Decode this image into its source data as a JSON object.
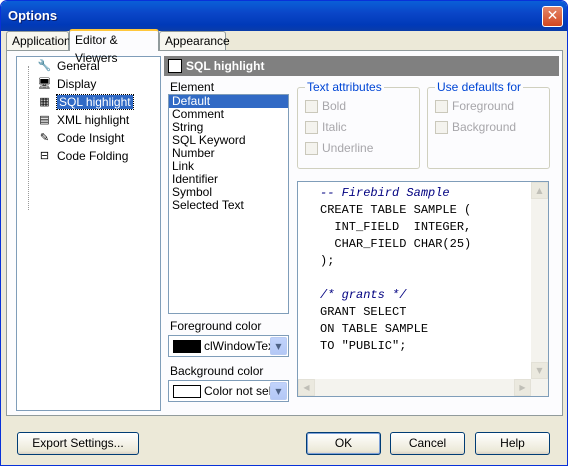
{
  "window": {
    "title": "Options"
  },
  "tabs": [
    {
      "label": "Application"
    },
    {
      "label": "Editor & Viewers"
    },
    {
      "label": "Appearance"
    }
  ],
  "tree": {
    "items": [
      {
        "label": "General",
        "icon": "wrench-icon"
      },
      {
        "label": "Display",
        "icon": "monitor-icon"
      },
      {
        "label": "SQL highlight",
        "icon": "grid-icon"
      },
      {
        "label": "XML highlight",
        "icon": "xml-doc-icon"
      },
      {
        "label": "Code Insight",
        "icon": "pencil-doc-icon"
      },
      {
        "label": "Code Folding",
        "icon": "folding-icon"
      }
    ],
    "selected": "SQL highlight"
  },
  "panel": {
    "title": "SQL highlight"
  },
  "element": {
    "label": "Element",
    "items": [
      "Default",
      "Comment",
      "String",
      "SQL Keyword",
      "Number",
      "Link",
      "Identifier",
      "Symbol",
      "Selected Text"
    ],
    "selected": "Default"
  },
  "text_attributes": {
    "label": "Text attributes",
    "bold": "Bold",
    "italic": "Italic",
    "underline": "Underline"
  },
  "use_defaults": {
    "label": "Use defaults for",
    "foreground": "Foreground",
    "background": "Background"
  },
  "foreground": {
    "label": "Foreground color",
    "value": "clWindowTex",
    "swatch": "#000000"
  },
  "background": {
    "label": "Background color",
    "value": "Color not sele",
    "swatch": "#ffffff"
  },
  "preview": {
    "lines": [
      "-- Firebird Sample",
      "CREATE TABLE SAMPLE (",
      "  INT_FIELD  INTEGER,",
      "  CHAR_FIELD CHAR(25)",
      ");",
      "",
      "/* grants */",
      "GRANT SELECT",
      "ON TABLE SAMPLE",
      "TO \"PUBLIC\";"
    ]
  },
  "buttons": {
    "export": "Export Settings...",
    "ok": "OK",
    "cancel": "Cancel",
    "help": "Help"
  },
  "colors": {
    "titlebar": "#0a46c8",
    "selection": "#316ac5",
    "group_label": "#0046d5"
  }
}
